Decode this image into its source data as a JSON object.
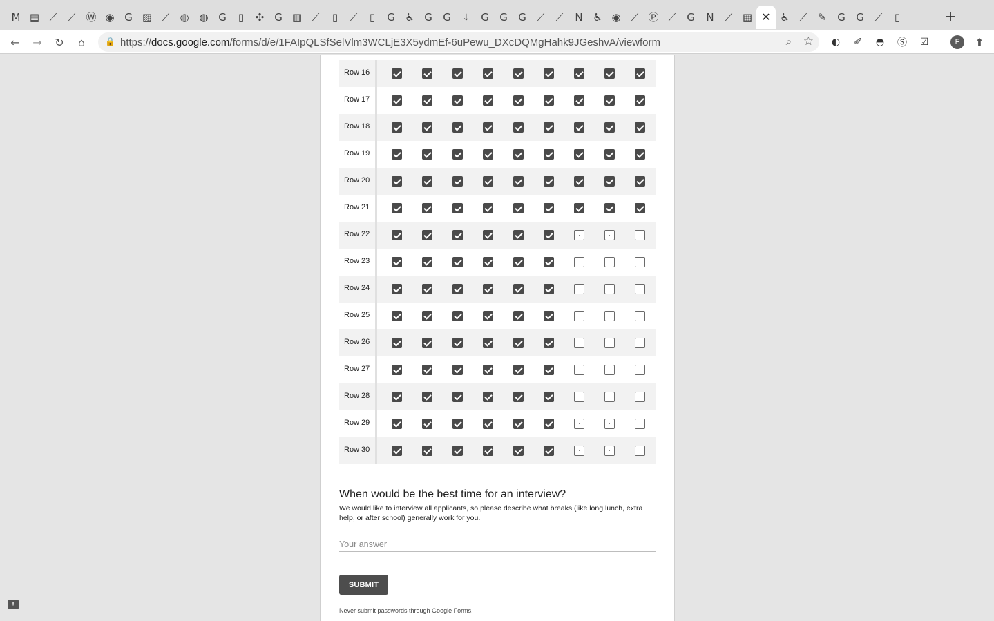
{
  "browser": {
    "tabs": [
      {
        "icon": "gmail-icon",
        "glyph": "M"
      },
      {
        "icon": "sheets-icon",
        "glyph": "▤"
      },
      {
        "icon": "generic-icon",
        "glyph": "⟋"
      },
      {
        "icon": "generic-icon",
        "glyph": "⟋"
      },
      {
        "icon": "wordpress-icon",
        "glyph": "Ⓦ"
      },
      {
        "icon": "github-icon",
        "glyph": "◉"
      },
      {
        "icon": "google-icon",
        "glyph": "G"
      },
      {
        "icon": "pattern-icon",
        "glyph": "▨"
      },
      {
        "icon": "generic-icon",
        "glyph": "⟋"
      },
      {
        "icon": "reddit-icon",
        "glyph": "◍"
      },
      {
        "icon": "reddit-icon",
        "glyph": "◍"
      },
      {
        "icon": "google-icon",
        "glyph": "G"
      },
      {
        "icon": "document-icon",
        "glyph": "▯"
      },
      {
        "icon": "network-icon",
        "glyph": "✣"
      },
      {
        "icon": "google-icon",
        "glyph": "G"
      },
      {
        "icon": "book-icon",
        "glyph": "▥"
      },
      {
        "icon": "generic-icon",
        "glyph": "⟋"
      },
      {
        "icon": "document-icon",
        "glyph": "▯"
      },
      {
        "icon": "generic-icon",
        "glyph": "⟋"
      },
      {
        "icon": "document-icon",
        "glyph": "▯"
      },
      {
        "icon": "google-icon",
        "glyph": "G"
      },
      {
        "icon": "accessibility-icon",
        "glyph": "♿"
      },
      {
        "icon": "google-icon",
        "glyph": "G"
      },
      {
        "icon": "google-icon",
        "glyph": "G"
      },
      {
        "icon": "download-icon",
        "glyph": "⤓"
      },
      {
        "icon": "google-icon",
        "glyph": "G"
      },
      {
        "icon": "google-icon",
        "glyph": "G"
      },
      {
        "icon": "google-icon",
        "glyph": "G"
      },
      {
        "icon": "generic-icon",
        "glyph": "⟋"
      },
      {
        "icon": "generic-icon",
        "glyph": "⟋"
      },
      {
        "icon": "notion-icon",
        "glyph": "N"
      },
      {
        "icon": "accessibility-icon",
        "glyph": "♿"
      },
      {
        "icon": "github-icon",
        "glyph": "◉"
      },
      {
        "icon": "generic-icon",
        "glyph": "⟋"
      },
      {
        "icon": "product-hunt-icon",
        "glyph": "Ⓟ"
      },
      {
        "icon": "generic-icon",
        "glyph": "⟋"
      },
      {
        "icon": "google-icon",
        "glyph": "G"
      },
      {
        "icon": "notion-icon",
        "glyph": "N"
      },
      {
        "icon": "generic-icon",
        "glyph": "⟋"
      },
      {
        "icon": "pattern-icon",
        "glyph": "▨"
      },
      {
        "icon": "close-icon",
        "glyph": "✕",
        "active": true
      },
      {
        "icon": "accessibility-icon",
        "glyph": "♿"
      },
      {
        "icon": "generic-icon",
        "glyph": "⟋"
      },
      {
        "icon": "pen-icon",
        "glyph": "✎"
      },
      {
        "icon": "google-icon",
        "glyph": "G"
      },
      {
        "icon": "google-icon",
        "glyph": "G"
      },
      {
        "icon": "generic-icon",
        "glyph": "⟋"
      },
      {
        "icon": "document-icon",
        "glyph": "▯"
      }
    ],
    "new_tab_glyph": "+",
    "url_scheme": "https://",
    "url_host": "docs.google.com",
    "url_path": "/forms/d/e/1FAIpQLSfSelVlm3WCLjE3X5ydmEf-6uPewu_DXcDQMgHahk9JGeshvA/viewform",
    "back_glyph": "←",
    "forward_glyph": "→",
    "reload_glyph": "↻",
    "home_glyph": "⌂",
    "lock_glyph": "🔒",
    "zoom_glyph": "⌕",
    "star_glyph": "☆",
    "extensions": [
      {
        "name": "extension-globe-icon",
        "glyph": "◐"
      },
      {
        "name": "extension-eyedropper-icon",
        "glyph": "✐"
      },
      {
        "name": "extension-incognito-icon",
        "glyph": "◓"
      },
      {
        "name": "extension-skype-icon",
        "glyph": "Ⓢ"
      },
      {
        "name": "extension-check-icon",
        "glyph": "☑"
      }
    ],
    "avatar_letter": "F",
    "update_glyph": "⬆"
  },
  "grid": {
    "rows": [
      {
        "label": "Row 16",
        "checks": [
          true,
          true,
          true,
          true,
          true,
          true,
          true,
          true,
          true
        ]
      },
      {
        "label": "Row 17",
        "checks": [
          true,
          true,
          true,
          true,
          true,
          true,
          true,
          true,
          true
        ]
      },
      {
        "label": "Row 18",
        "checks": [
          true,
          true,
          true,
          true,
          true,
          true,
          true,
          true,
          true
        ]
      },
      {
        "label": "Row 19",
        "checks": [
          true,
          true,
          true,
          true,
          true,
          true,
          true,
          true,
          true
        ]
      },
      {
        "label": "Row 20",
        "checks": [
          true,
          true,
          true,
          true,
          true,
          true,
          true,
          true,
          true
        ]
      },
      {
        "label": "Row 21",
        "checks": [
          true,
          true,
          true,
          true,
          true,
          true,
          true,
          true,
          true
        ]
      },
      {
        "label": "Row 22",
        "checks": [
          true,
          true,
          true,
          true,
          true,
          true,
          false,
          false,
          false
        ]
      },
      {
        "label": "Row 23",
        "checks": [
          true,
          true,
          true,
          true,
          true,
          true,
          false,
          false,
          false
        ]
      },
      {
        "label": "Row 24",
        "checks": [
          true,
          true,
          true,
          true,
          true,
          true,
          false,
          false,
          false
        ]
      },
      {
        "label": "Row 25",
        "checks": [
          true,
          true,
          true,
          true,
          true,
          true,
          false,
          false,
          false
        ]
      },
      {
        "label": "Row 26",
        "checks": [
          true,
          true,
          true,
          true,
          true,
          true,
          false,
          false,
          false
        ]
      },
      {
        "label": "Row 27",
        "checks": [
          true,
          true,
          true,
          true,
          true,
          true,
          false,
          false,
          false
        ]
      },
      {
        "label": "Row 28",
        "checks": [
          true,
          true,
          true,
          true,
          true,
          true,
          false,
          false,
          false
        ]
      },
      {
        "label": "Row 29",
        "checks": [
          true,
          true,
          true,
          true,
          true,
          true,
          false,
          false,
          false
        ]
      },
      {
        "label": "Row 30",
        "checks": [
          true,
          true,
          true,
          true,
          true,
          true,
          false,
          false,
          false
        ]
      }
    ]
  },
  "question": {
    "title": "When would be the best time for an interview?",
    "description": "We would like to interview all applicants, so please describe what breaks (like long lunch, extra help, or after school) generally work for you.",
    "answer_placeholder": "Your answer"
  },
  "form": {
    "submit_label": "SUBMIT",
    "never_submit": "Never submit passwords through Google Forms.",
    "feedback_glyph": "!"
  }
}
